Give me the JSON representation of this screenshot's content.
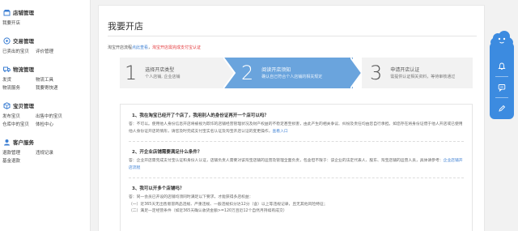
{
  "sidebar": {
    "groups": [
      {
        "title": "店铺管理",
        "icon": "store-icon",
        "items": [
          "我要开店"
        ]
      },
      {
        "title": "交易管理",
        "icon": "trade-icon",
        "items": [
          "已卖出的宝贝",
          "评价管理"
        ]
      },
      {
        "title": "物流管理",
        "icon": "truck-icon",
        "items": [
          "发货",
          "物流工具",
          "物流服务",
          "我要寄快递"
        ]
      },
      {
        "title": "宝贝管理",
        "icon": "box-icon",
        "items": [
          "发布宝贝",
          "出售中的宝贝",
          "仓库中的宝贝",
          "体检中心"
        ]
      },
      {
        "title": "客户服务",
        "icon": "service-icon",
        "items": [
          "退款管理",
          "违规记录",
          "基金退款"
        ]
      }
    ]
  },
  "main": {
    "title": "我要开店",
    "flow_prefix": "淘宝开店流程",
    "flow_link": "点此查看",
    "flow_sep": "，",
    "flow_warning": "淘宝开店需完成支付宝认证"
  },
  "steps": [
    {
      "num": "1",
      "title": "选择开店类型",
      "sub": "个人店铺, 企业店铺"
    },
    {
      "num": "2",
      "title": "阅读开店须知",
      "sub": "确认自己符合个人店铺的相关规定"
    },
    {
      "num": "3",
      "title": "申请开店认证",
      "sub": "需提供认证相关资料，等待审核通过"
    }
  ],
  "faq": [
    {
      "q": "1、我在淘宝已经开了个店了，我用别人的身份证再开一个店可以吗？",
      "a": "答：不可以。使用他人身份信息开店将被视为欺诈的店铺经营管理状况及财产权益的不稳定甚至损害，由此产生的相关争议、纠纷及责任均由您自行承担。如您存在将身份证借于他人开店或已使用他人身份证开店的情形，请您及时完成支付宝实名认证及淘宝开店认证的变更操作，",
      "link": "查看入口"
    },
    {
      "q": "2、开企业店铺需要满足什么条件？",
      "a": "答：企业开店需完成支付宝认证和身份人认证，店铺负责人需要对该淘宝店铺的运营及管理全面负责，包含但不限于：该企业的法定代表人、股东、淘宝店铺的运营人员，具体请参考：",
      "link": "企业店铺开店流程"
    },
    {
      "q": "3、我可以开多个店铺吗？",
      "a": "答：同一会员已开设的店铺均须同时满足以下要求，才能获得多店权益：",
      "lines": [
        "（一）近365天无出售假冒商品违规、严重违规、一般违规扣分达12分（含）以上等违规记录，且无其他风险特征；",
        "（二）满足一定经营条件（如近365天确认收货金额>=120万且近12个自然月持续有成交）"
      ]
    }
  ],
  "float": {
    "icons": [
      "cloud-icon",
      "bell-icon",
      "chat-icon",
      "edit-icon"
    ]
  }
}
